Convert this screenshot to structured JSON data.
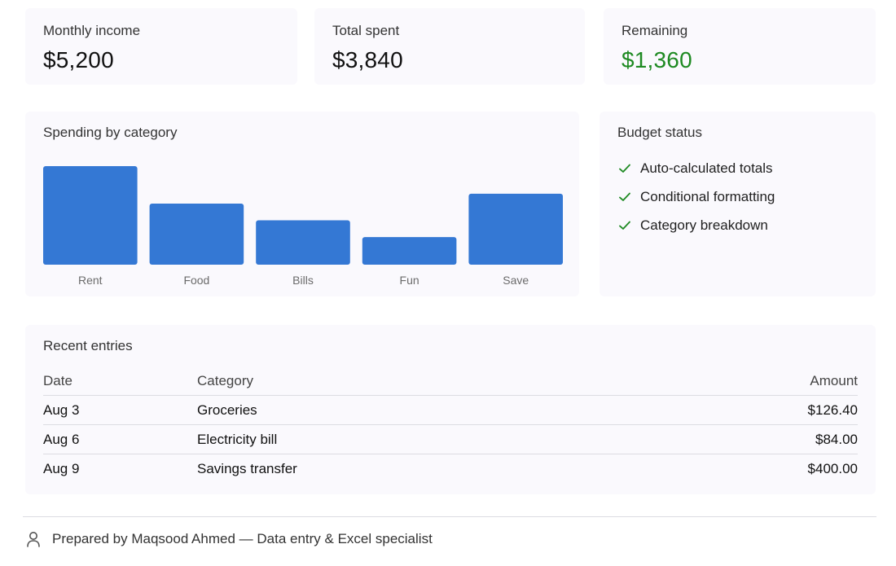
{
  "stats": [
    {
      "label": "Monthly income",
      "value": "$5,200"
    },
    {
      "label": "Total spent",
      "value": "$3,840"
    },
    {
      "label": "Remaining",
      "value": "$1,360",
      "color": "#1e8a22"
    }
  ],
  "spending": {
    "title": "Spending by category"
  },
  "chart_data": {
    "type": "bar",
    "categories": [
      "Rent",
      "Food",
      "Bills",
      "Fun",
      "Save"
    ],
    "values": [
      100,
      62,
      45,
      28,
      72
    ],
    "ylim": [
      0,
      100
    ],
    "grid": false,
    "bar_color": "#3478d4"
  },
  "budget_status": {
    "title": "Budget status",
    "items": [
      "Auto-calculated totals",
      "Conditional formatting",
      "Category breakdown"
    ],
    "icon": "check-icon",
    "icon_color": "#1e8a22"
  },
  "recent": {
    "title": "Recent entries",
    "columns": [
      "Date",
      "Category",
      "Amount"
    ],
    "rows": [
      [
        "Aug 3",
        "Groceries",
        "$126.40"
      ],
      [
        "Aug 6",
        "Electricity bill",
        "$84.00"
      ],
      [
        "Aug 9",
        "Savings transfer",
        "$400.00"
      ]
    ]
  },
  "footer": {
    "text": "Prepared by Maqsood Ahmed — Data entry & Excel specialist",
    "icon": "user-icon"
  }
}
